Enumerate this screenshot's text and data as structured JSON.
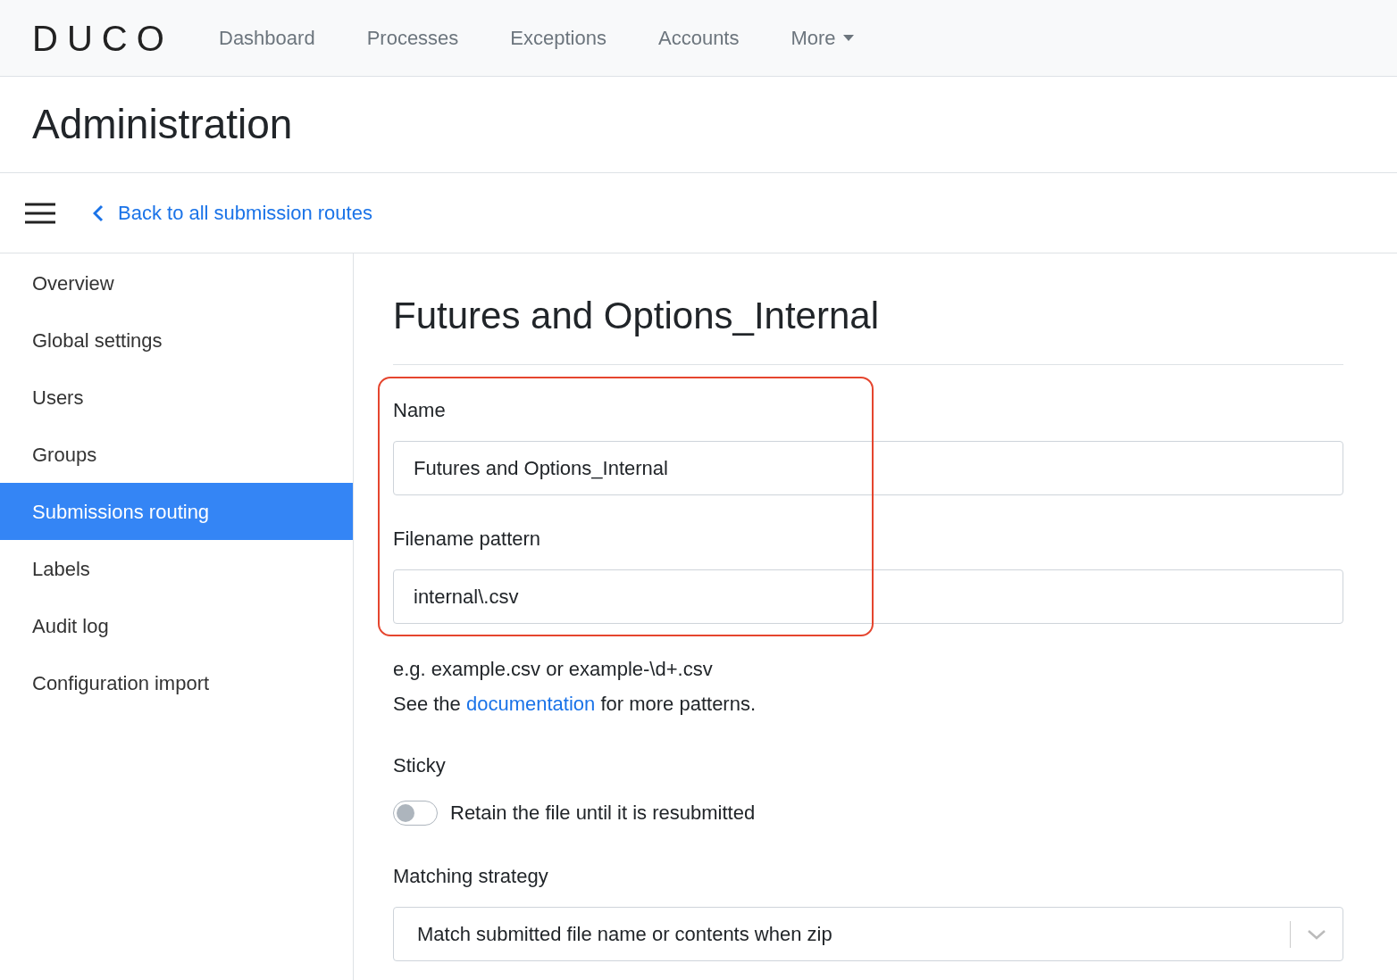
{
  "logo": "DUCO",
  "nav": [
    {
      "label": "Dashboard"
    },
    {
      "label": "Processes"
    },
    {
      "label": "Exceptions"
    },
    {
      "label": "Accounts"
    },
    {
      "label": "More",
      "kind": "dropdown"
    }
  ],
  "page_title": "Administration",
  "back_link": "Back to all submission routes",
  "sidebar": [
    {
      "label": "Overview",
      "selected": false
    },
    {
      "label": "Global settings",
      "selected": false
    },
    {
      "label": "Users",
      "selected": false
    },
    {
      "label": "Groups",
      "selected": false
    },
    {
      "label": "Submissions routing",
      "selected": true
    },
    {
      "label": "Labels",
      "selected": false
    },
    {
      "label": "Audit log",
      "selected": false
    },
    {
      "label": "Configuration import",
      "selected": false
    }
  ],
  "form": {
    "title": "Futures and Options_Internal",
    "name": {
      "label": "Name",
      "value": "Futures and Options_Internal"
    },
    "filename_pattern": {
      "label": "Filename pattern",
      "value": "internal\\.csv"
    },
    "hint": "e.g. example.csv or example-\\d+.csv",
    "help": {
      "before": "See the",
      "link": "documentation",
      "after": "for more patterns."
    },
    "sticky": {
      "label": "Sticky",
      "toggle_label": "Retain the file until it is resubmitted",
      "on": false
    },
    "matching_strategy": {
      "label": "Matching strategy",
      "value": "Match submitted file name or contents when zip"
    }
  }
}
